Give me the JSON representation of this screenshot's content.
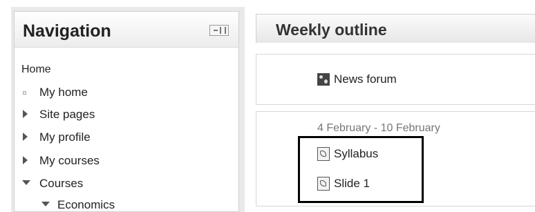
{
  "navigation": {
    "title": "Navigation",
    "items": [
      {
        "label": "Home"
      },
      {
        "label": "My home"
      },
      {
        "label": "Site pages"
      },
      {
        "label": "My profile"
      },
      {
        "label": "My courses"
      },
      {
        "label": "Courses"
      },
      {
        "label": "Economics"
      }
    ]
  },
  "main": {
    "title": "Weekly outline",
    "general_section": {
      "activities": [
        {
          "label": "News forum",
          "icon": "forum-icon"
        }
      ]
    },
    "week_section": {
      "dates": "4 February - 10 February",
      "activities": [
        {
          "label": "Syllabus",
          "icon": "pdf-icon"
        },
        {
          "label": "Slide 1",
          "icon": "pdf-icon"
        }
      ]
    }
  }
}
